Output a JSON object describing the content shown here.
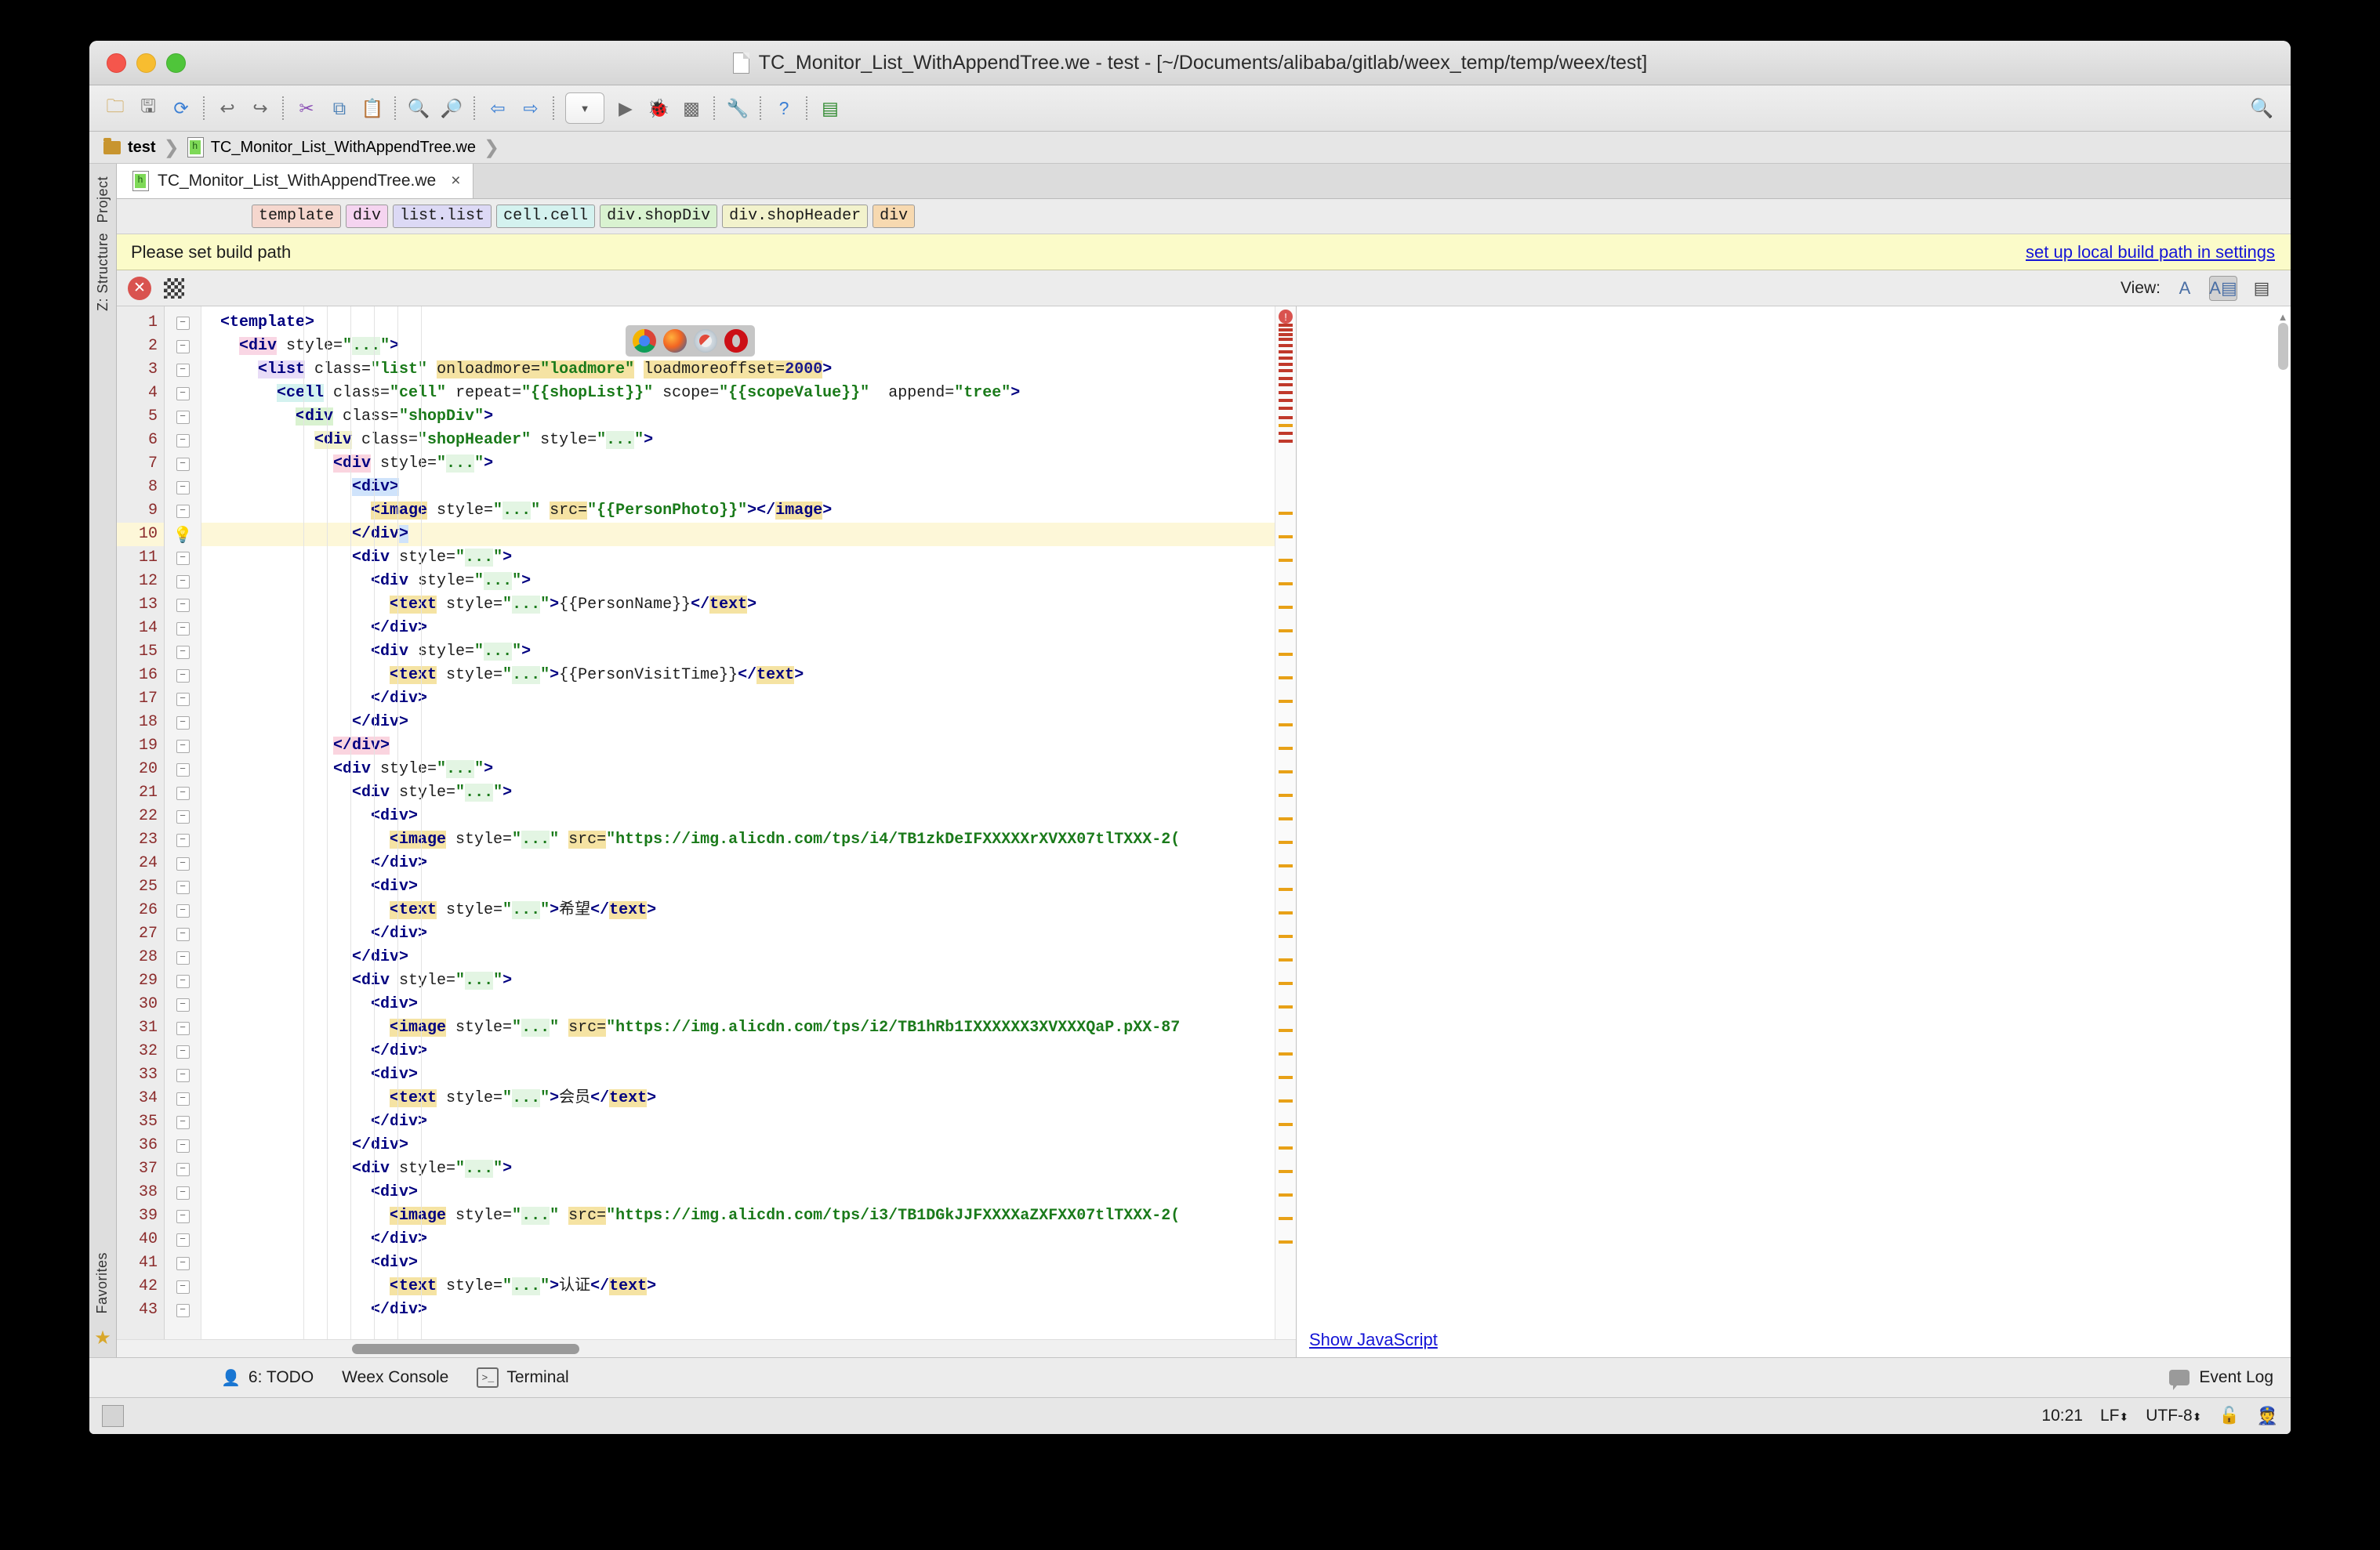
{
  "window": {
    "title": "TC_Monitor_List_WithAppendTree.we - test - [~/Documents/alibaba/gitlab/weex_temp/temp/weex/test]"
  },
  "toolbar": {
    "buttons": [
      {
        "name": "open-folder-icon",
        "glyph": "📁"
      },
      {
        "name": "save-icon",
        "glyph": "💾"
      },
      {
        "name": "sync-icon",
        "glyph": "↻"
      },
      {
        "name": "undo-icon",
        "glyph": "↶"
      },
      {
        "name": "redo-icon",
        "glyph": "↷"
      },
      {
        "name": "cut-icon",
        "glyph": "✂"
      },
      {
        "name": "copy-icon",
        "glyph": "⧉"
      },
      {
        "name": "paste-icon",
        "glyph": "📋"
      },
      {
        "name": "find-icon",
        "glyph": "🔍"
      },
      {
        "name": "replace-icon",
        "glyph": "🔎"
      },
      {
        "name": "back-icon",
        "glyph": "⇦"
      },
      {
        "name": "forward-icon",
        "glyph": "⇨"
      },
      {
        "name": "run-config-dropdown",
        "glyph": "▼"
      },
      {
        "name": "run-icon",
        "glyph": "▶"
      },
      {
        "name": "debug-icon",
        "glyph": "🐞"
      },
      {
        "name": "coverage-icon",
        "glyph": "░"
      },
      {
        "name": "settings-icon",
        "glyph": "🔧"
      },
      {
        "name": "help-icon",
        "glyph": "?"
      },
      {
        "name": "device-icon",
        "glyph": "⬛"
      }
    ],
    "search_glyph": "🔍"
  },
  "breadcrumb": {
    "items": [
      {
        "label": "test",
        "icon": "folder-icon"
      },
      {
        "label": "TC_Monitor_List_WithAppendTree.we",
        "icon": "weex-file-icon"
      }
    ]
  },
  "tabs": [
    {
      "label": "TC_Monitor_List_WithAppendTree.we",
      "close": "×",
      "active": true
    }
  ],
  "element_path_chips": [
    {
      "label": "template",
      "color": "#f5d7ce"
    },
    {
      "label": "div",
      "color": "#f5d4f0"
    },
    {
      "label": "list.list",
      "color": "#dcd9f5"
    },
    {
      "label": "cell.cell",
      "color": "#d4f2ef"
    },
    {
      "label": "div.shopDiv",
      "color": "#d9f2d0"
    },
    {
      "label": "div.shopHeader",
      "color": "#f2f2cc"
    },
    {
      "label": "div",
      "color": "#f7d9b0"
    }
  ],
  "warning_banner": {
    "message": "Please set build path",
    "link": "set up local build path in settings"
  },
  "view_bar": {
    "error_badge": "✕",
    "qr_icon": "qr-code-icon",
    "view_label": "View:",
    "options": [
      {
        "name": "view-text-only",
        "glyph": "A",
        "active": false
      },
      {
        "name": "view-text-and-preview",
        "glyph": "A▤",
        "active": true
      },
      {
        "name": "view-preview-only",
        "glyph": "▤",
        "active": false
      }
    ]
  },
  "browsers": [
    {
      "name": "chrome-icon"
    },
    {
      "name": "firefox-icon"
    },
    {
      "name": "safari-icon"
    },
    {
      "name": "opera-icon"
    }
  ],
  "editor": {
    "highlighted_line": 10,
    "error_marker": "!",
    "lines": [
      {
        "n": 1,
        "indent": 0,
        "html": "<span class=\"t-tag\">&lt;template&gt;</span>"
      },
      {
        "n": 2,
        "indent": 1,
        "html": "<span class=\"t-tag hl-p\">&lt;div</span> <span class=\"t-attr\">style=</span><span class=\"t-str\">\"<span class=\"hl-g\">...</span>\"</span><span class=\"t-tag\">&gt;</span>"
      },
      {
        "n": 3,
        "indent": 2,
        "html": "<span class=\"t-tag hl-pu\">&lt;list</span> <span class=\"t-attr\">class=</span><span class=\"t-str\">\"list\"</span> <span class=\"hl-y\">onloadmore=</span><span class=\"t-str hl-y\">\"loadmore\"</span> <span class=\"hl-y\">loadmoreoffset=</span><span class=\"t-num hl-y\">2000</span><span class=\"t-tag\">&gt;</span>"
      },
      {
        "n": 4,
        "indent": 3,
        "html": "<span class=\"t-tag hl-c\">&lt;cell</span> <span class=\"t-attr\">class=</span><span class=\"t-str\">\"cell\"</span> <span class=\"t-attr\">repeat=</span><span class=\"t-str\">\"{{shopList}}\"</span> <span class=\"t-attr\">scope=</span><span class=\"t-str\">\"{{scopeValue}}\"</span>  <span class=\"t-attr\">append=</span><span class=\"t-str\">\"tree\"</span><span class=\"t-tag\">&gt;</span>"
      },
      {
        "n": 5,
        "indent": 4,
        "html": "<span class=\"t-tag hl-lg\">&lt;div</span> <span class=\"t-attr\">class=</span><span class=\"t-str\">\"shopDiv\"</span><span class=\"t-tag\">&gt;</span>"
      },
      {
        "n": 6,
        "indent": 5,
        "html": "<span class=\"t-tag hl-ly\">&lt;div</span> <span class=\"t-attr\">class=</span><span class=\"t-str\">\"shopHeader\"</span> <span class=\"t-attr\">style=</span><span class=\"t-str\">\"<span class=\"hl-g\">...</span>\"</span><span class=\"t-tag\">&gt;</span>"
      },
      {
        "n": 7,
        "indent": 6,
        "html": "<span class=\"t-tag hl-pink\">&lt;div</span> <span class=\"t-attr\">style=</span><span class=\"t-str\">\"<span class=\"hl-g\">...</span>\"</span><span class=\"t-tag\">&gt;</span>"
      },
      {
        "n": 8,
        "indent": 7,
        "html": "<span class=\"t-tag hl-b\">&lt;div&gt;</span>"
      },
      {
        "n": 9,
        "indent": 8,
        "html": "<span class=\"t-tag hl-y\">&lt;image</span> <span class=\"t-attr\">style=</span><span class=\"t-str\">\"<span class=\"hl-g\">...</span>\"</span> <span class=\"hl-y\">src=</span><span class=\"t-str\">\"{{PersonPhoto}}\"</span><span class=\"t-tag\">&gt;&lt;/</span><span class=\"t-tag hl-y\">image</span><span class=\"t-tag\">&gt;</span>"
      },
      {
        "n": 10,
        "indent": 7,
        "html": "<span class=\"t-tag\">&lt;/div</span><span class=\"t-tag hl-b\">&gt;</span>"
      },
      {
        "n": 11,
        "indent": 7,
        "html": "<span class=\"t-tag\">&lt;div</span> <span class=\"t-attr\">style=</span><span class=\"t-str\">\"<span class=\"hl-g\">...</span>\"</span><span class=\"t-tag\">&gt;</span>"
      },
      {
        "n": 12,
        "indent": 8,
        "html": "<span class=\"t-tag\">&lt;div</span> <span class=\"t-attr\">style=</span><span class=\"t-str\">\"<span class=\"hl-g\">...</span>\"</span><span class=\"t-tag\">&gt;</span>"
      },
      {
        "n": 13,
        "indent": 9,
        "html": "<span class=\"t-tag hl-y\">&lt;text</span> <span class=\"t-attr\">style=</span><span class=\"t-str\">\"<span class=\"hl-g\">...</span>\"</span><span class=\"t-tag\">&gt;</span>{{PersonName}}<span class=\"t-tag\">&lt;/</span><span class=\"t-tag hl-y\">text</span><span class=\"t-tag\">&gt;</span>"
      },
      {
        "n": 14,
        "indent": 8,
        "html": "<span class=\"t-tag\">&lt;/div&gt;</span>"
      },
      {
        "n": 15,
        "indent": 8,
        "html": "<span class=\"t-tag\">&lt;div</span> <span class=\"t-attr\">style=</span><span class=\"t-str\">\"<span class=\"hl-g\">...</span>\"</span><span class=\"t-tag\">&gt;</span>"
      },
      {
        "n": 16,
        "indent": 9,
        "html": "<span class=\"t-tag hl-y\">&lt;text</span> <span class=\"t-attr\">style=</span><span class=\"t-str\">\"<span class=\"hl-g\">...</span>\"</span><span class=\"t-tag\">&gt;</span>{{PersonVisitTime}}<span class=\"t-tag\">&lt;/</span><span class=\"t-tag hl-y\">text</span><span class=\"t-tag\">&gt;</span>"
      },
      {
        "n": 17,
        "indent": 8,
        "html": "<span class=\"t-tag\">&lt;/div&gt;</span>"
      },
      {
        "n": 18,
        "indent": 7,
        "html": "<span class=\"t-tag\">&lt;/div&gt;</span>"
      },
      {
        "n": 19,
        "indent": 6,
        "html": "<span class=\"t-tag hl-pink\">&lt;/div&gt;</span>"
      },
      {
        "n": 20,
        "indent": 6,
        "html": "<span class=\"t-tag\">&lt;div</span> <span class=\"t-attr\">style=</span><span class=\"t-str\">\"<span class=\"hl-g\">...</span>\"</span><span class=\"t-tag\">&gt;</span>"
      },
      {
        "n": 21,
        "indent": 7,
        "html": "<span class=\"t-tag\">&lt;div</span> <span class=\"t-attr\">style=</span><span class=\"t-str\">\"<span class=\"hl-g\">...</span>\"</span><span class=\"t-tag\">&gt;</span>"
      },
      {
        "n": 22,
        "indent": 8,
        "html": "<span class=\"t-tag\">&lt;div&gt;</span>"
      },
      {
        "n": 23,
        "indent": 9,
        "html": "<span class=\"t-tag hl-y\">&lt;image</span> <span class=\"t-attr\">style=</span><span class=\"t-str\">\"<span class=\"hl-g\">...</span>\"</span> <span class=\"hl-y\">src=</span><span class=\"t-str\">\"https://img.alicdn.com/tps/i4/TB1zkDeIFXXXXXrXVXX07tlTXXX-2(</span>"
      },
      {
        "n": 24,
        "indent": 8,
        "html": "<span class=\"t-tag\">&lt;/div&gt;</span>"
      },
      {
        "n": 25,
        "indent": 8,
        "html": "<span class=\"t-tag\">&lt;div&gt;</span>"
      },
      {
        "n": 26,
        "indent": 9,
        "html": "<span class=\"t-tag hl-y\">&lt;text</span> <span class=\"t-attr\">style=</span><span class=\"t-str\">\"<span class=\"hl-g\">...</span>\"</span><span class=\"t-tag\">&gt;</span>希望<span class=\"t-tag\">&lt;/</span><span class=\"t-tag hl-y\">text</span><span class=\"t-tag\">&gt;</span>"
      },
      {
        "n": 27,
        "indent": 8,
        "html": "<span class=\"t-tag\">&lt;/div&gt;</span>"
      },
      {
        "n": 28,
        "indent": 7,
        "html": "<span class=\"t-tag\">&lt;/div&gt;</span>"
      },
      {
        "n": 29,
        "indent": 7,
        "html": "<span class=\"t-tag\">&lt;div</span> <span class=\"t-attr\">style=</span><span class=\"t-str\">\"<span class=\"hl-g\">...</span>\"</span><span class=\"t-tag\">&gt;</span>"
      },
      {
        "n": 30,
        "indent": 8,
        "html": "<span class=\"t-tag\">&lt;div&gt;</span>"
      },
      {
        "n": 31,
        "indent": 9,
        "html": "<span class=\"t-tag hl-y\">&lt;image</span> <span class=\"t-attr\">style=</span><span class=\"t-str\">\"<span class=\"hl-g\">...</span>\"</span> <span class=\"hl-y\">src=</span><span class=\"t-str\">\"https://img.alicdn.com/tps/i2/TB1hRb1IXXXXXX3XVXXXQaP.pXX-87</span>"
      },
      {
        "n": 32,
        "indent": 8,
        "html": "<span class=\"t-tag\">&lt;/div&gt;</span>"
      },
      {
        "n": 33,
        "indent": 8,
        "html": "<span class=\"t-tag\">&lt;div&gt;</span>"
      },
      {
        "n": 34,
        "indent": 9,
        "html": "<span class=\"t-tag hl-y\">&lt;text</span> <span class=\"t-attr\">style=</span><span class=\"t-str\">\"<span class=\"hl-g\">...</span>\"</span><span class=\"t-tag\">&gt;</span>会员<span class=\"t-tag\">&lt;/</span><span class=\"t-tag hl-y\">text</span><span class=\"t-tag\">&gt;</span>"
      },
      {
        "n": 35,
        "indent": 8,
        "html": "<span class=\"t-tag\">&lt;/div&gt;</span>"
      },
      {
        "n": 36,
        "indent": 7,
        "html": "<span class=\"t-tag\">&lt;/div&gt;</span>"
      },
      {
        "n": 37,
        "indent": 7,
        "html": "<span class=\"t-tag\">&lt;div</span> <span class=\"t-attr\">style=</span><span class=\"t-str\">\"<span class=\"hl-g\">...</span>\"</span><span class=\"t-tag\">&gt;</span>"
      },
      {
        "n": 38,
        "indent": 8,
        "html": "<span class=\"t-tag\">&lt;div&gt;</span>"
      },
      {
        "n": 39,
        "indent": 9,
        "html": "<span class=\"t-tag hl-y\">&lt;image</span> <span class=\"t-attr\">style=</span><span class=\"t-str\">\"<span class=\"hl-g\">...</span>\"</span> <span class=\"hl-y\">src=</span><span class=\"t-str\">\"https://img.alicdn.com/tps/i3/TB1DGkJJFXXXXaZXFXX07tlTXXX-2(</span>"
      },
      {
        "n": 40,
        "indent": 8,
        "html": "<span class=\"t-tag\">&lt;/div&gt;</span>"
      },
      {
        "n": 41,
        "indent": 8,
        "html": "<span class=\"t-tag\">&lt;div&gt;</span>"
      },
      {
        "n": 42,
        "indent": 9,
        "html": "<span class=\"t-tag hl-y\">&lt;text</span> <span class=\"t-attr\">style=</span><span class=\"t-str\">\"<span class=\"hl-g\">...</span>\"</span><span class=\"t-tag\">&gt;</span>认证<span class=\"t-tag\">&lt;/</span><span class=\"t-tag hl-y\">text</span><span class=\"t-tag\">&gt;</span>"
      },
      {
        "n": 43,
        "indent": 8,
        "html": "<span class=\"t-tag\">&lt;/div&gt;</span>"
      }
    ]
  },
  "preview": {
    "show_javascript_link": "Show JavaScript"
  },
  "tool_windows": {
    "items": [
      {
        "label": "6: TODO",
        "number": "6",
        "rest": ": TODO",
        "icon": "todo-person-icon"
      },
      {
        "label": "Weex Console",
        "icon": null
      },
      {
        "label": "Terminal",
        "icon": "terminal-icon"
      }
    ],
    "event_log": "Event Log"
  },
  "status_bar": {
    "time": "10:21",
    "line_separator": "LF",
    "encoding": "UTF-8",
    "lock_icon": "lock-icon",
    "inspector_icon": "inspector-hat-icon"
  },
  "rail": {
    "left_items": [
      "Project",
      "Z: Structure"
    ],
    "bottom_item": "Favorites"
  }
}
